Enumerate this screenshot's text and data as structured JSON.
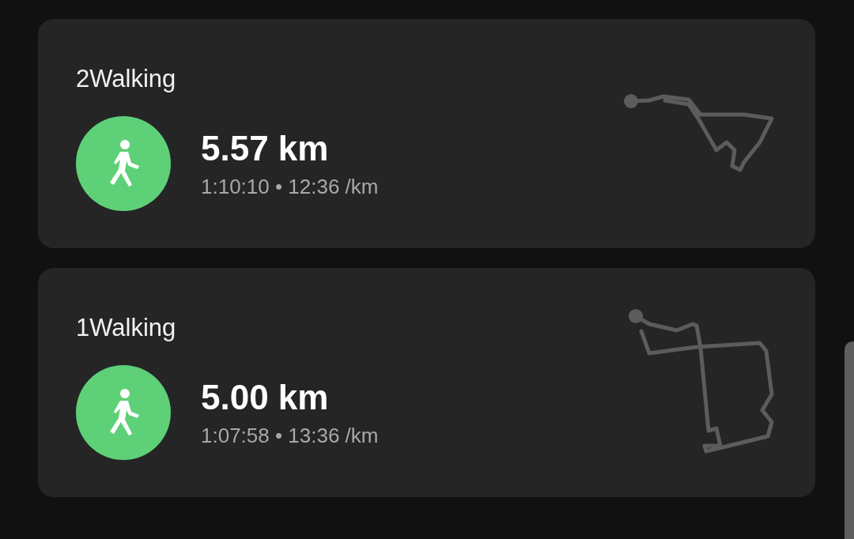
{
  "activities": [
    {
      "title": "2Walking",
      "kind": "walking",
      "distance": "5.57 km",
      "stats": "1:10:10 • 12:36 /km"
    },
    {
      "title": "1Walking",
      "kind": "walking",
      "distance": "5.00 km",
      "stats": "1:07:58 • 13:36 /km"
    }
  ]
}
